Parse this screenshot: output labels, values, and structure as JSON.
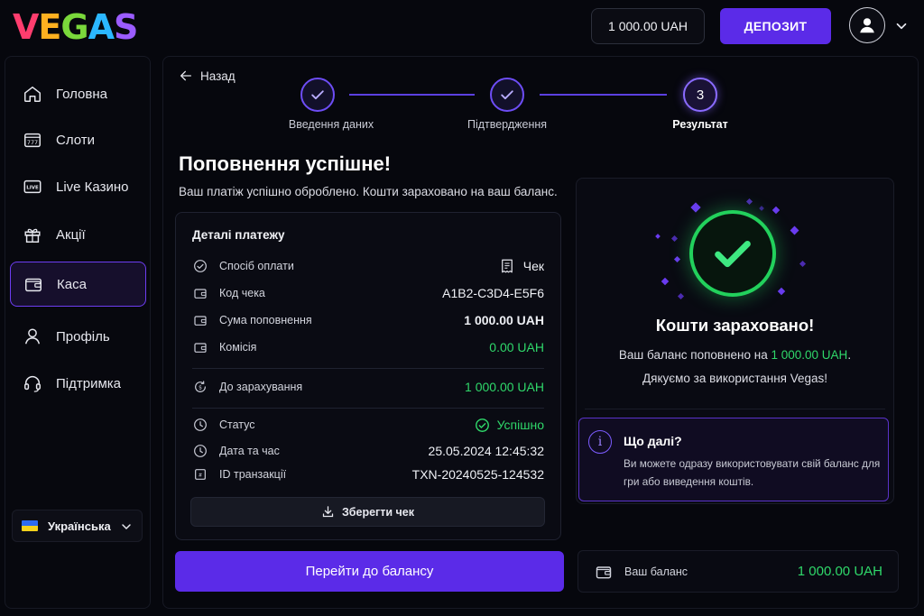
{
  "header": {
    "logo": "VEGAS",
    "balance": "1 000.00 UAH",
    "deposit_label": "ДЕПОЗИТ"
  },
  "sidebar": {
    "items": [
      {
        "label": "Головна",
        "icon": "home-icon"
      },
      {
        "label": "Слоти",
        "icon": "slot-machine-icon"
      },
      {
        "label": "Live Казино",
        "icon": "live-icon"
      },
      {
        "label": "Акції",
        "icon": "gift-icon"
      },
      {
        "label": "Каса",
        "icon": "wallet-icon",
        "active": true
      },
      {
        "label": "Профіль",
        "icon": "user-icon"
      },
      {
        "label": "Підтримка",
        "icon": "headset-icon"
      }
    ],
    "language": "Українська"
  },
  "main": {
    "back_label": "Назад",
    "steps": [
      {
        "label": "Введення даних",
        "state": "done"
      },
      {
        "label": "Підтвердження",
        "state": "done"
      },
      {
        "label": "Результат",
        "number": "3",
        "state": "current"
      }
    ],
    "title": "Поповнення успішне!",
    "subtitle": "Ваш платіж успішно оброблено. Кошти зараховано на ваш баланс.",
    "details": {
      "title": "Деталі платежу",
      "rows": [
        {
          "label": "Спосіб оплати",
          "value": "Чек"
        },
        {
          "label": "Код чека",
          "value": "A1B2-C3D4-E5F6"
        },
        {
          "label": "Сума поповнення",
          "value": "1 000.00 UAH"
        },
        {
          "label": "Комісія",
          "value": "0.00 UAH"
        },
        {
          "label": "До зарахування",
          "value": "1 000.00 UAH"
        },
        {
          "label": "Статус",
          "value": "Успішно"
        },
        {
          "label": "Дата та час",
          "value": "25.05.2024 12:45:32"
        },
        {
          "label": "ID транзакції",
          "value": "TXN-20240525-124532"
        }
      ],
      "save_label": "Зберегти чек"
    },
    "goto_balance_label": "Перейти до балансу"
  },
  "result_card": {
    "title": "Кошти зараховано!",
    "line1_prefix": "Ваш баланс поповнено на ",
    "line1_amount": "1 000.00 UAH",
    "line1_suffix": ".",
    "line2": "Дякуємо за використання Vegas!",
    "next_title": "Що далі?",
    "next_text": "Ви можете одразу використовувати свій баланс для гри або виведення коштів."
  },
  "balance_card": {
    "label": "Ваш баланс",
    "value": "1 000.00 UAH"
  },
  "colors": {
    "accent": "#5b2be8",
    "success": "#2fd86a",
    "background": "#06070d"
  }
}
